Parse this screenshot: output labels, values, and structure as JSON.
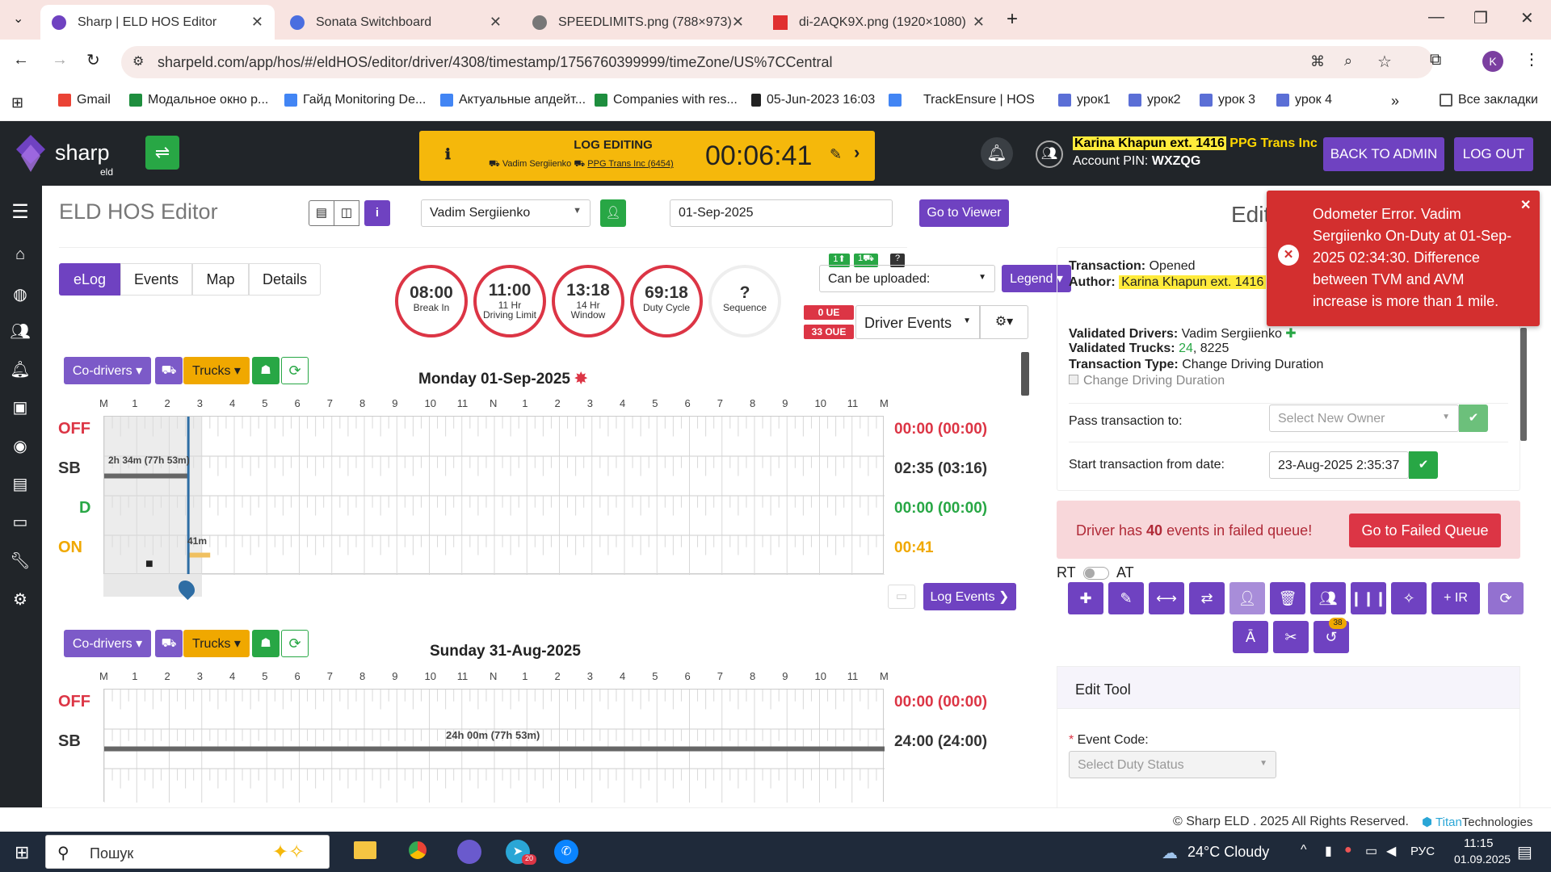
{
  "browser": {
    "tabs": [
      {
        "title": "Sharp | ELD HOS Editor",
        "active": true
      },
      {
        "title": "Sonata Switchboard",
        "active": false
      },
      {
        "title": "SPEEDLIMITS.png (788×973)",
        "active": false
      },
      {
        "title": "di-2AQK9X.png (1920×1080)",
        "active": false
      }
    ],
    "url": "sharpeld.com/app/hos/#/eldHOS/editor/driver/4308/timestamp/1756760399999/timeZone/US%7CCentral",
    "profile_initial": "K",
    "bookmarks": [
      "Gmail",
      "Модальное окно р...",
      "Гайд Monitoring De...",
      "Актуальные апдейт...",
      "Companies with res...",
      "05-Jun-2023 16:03",
      "TrackEnsure | HOS",
      "урок1",
      "урок2",
      "урок 3",
      "урок 4"
    ],
    "all_bookmarks": "Все закладки"
  },
  "header": {
    "logo_text": "sharp",
    "logo_sub": "eld",
    "log_editing_title": "LOG EDITING",
    "log_editing_driver": "Vadim Sergiienko",
    "log_editing_company": "PPG Trans Inc (6454)",
    "timer": "00:06:41",
    "user_name": "Karina Khapun ext. 1416",
    "company": "PPG Trans Inc",
    "pin_label": "Account PIN:",
    "pin_value": "WXZQG",
    "back_to_admin": "BACK TO ADMIN",
    "log_out": "LOG OUT"
  },
  "toolbar": {
    "page_title": "ELD HOS Editor",
    "driver_select": "Vadim Sergiienko",
    "date": "01-Sep-2025",
    "go_viewer": "Go to Viewer",
    "tabs": [
      "eLog",
      "Events",
      "Map",
      "Details"
    ]
  },
  "clocks": [
    {
      "time": "08:00",
      "label": "Break In",
      "sub": ""
    },
    {
      "time": "11:00",
      "label": "Driving Limit",
      "sub": "11 Hr"
    },
    {
      "time": "13:18",
      "label": "Window",
      "sub": "14 Hr"
    },
    {
      "time": "69:18",
      "label": "Duty Cycle",
      "sub": ""
    },
    {
      "time": "?",
      "label": "Sequence",
      "sub": ""
    }
  ],
  "upload": {
    "badge1": "1",
    "badge2": "1",
    "badge3": "?",
    "label": "Can be uploaded:",
    "legend": "Legend",
    "ue": "0 UE",
    "oue": "33 OUE",
    "driver_events": "Driver Events"
  },
  "days": [
    {
      "title": "Monday 01-Sep-2025",
      "totals": [
        "00:00 (00:00)",
        "02:35 (03:16)",
        "00:00 (00:00)",
        "00:41"
      ],
      "sb_label": "2h 34m (77h 53m)",
      "on_label": "41m"
    },
    {
      "title": "Sunday 31-Aug-2025",
      "totals": [
        "00:00 (00:00)",
        "24:00 (24:00)"
      ],
      "sb_label": "24h 00m (77h 53m)"
    }
  ],
  "status_rows": [
    "OFF",
    "SB",
    "D",
    "ON"
  ],
  "hours": [
    "M",
    "1",
    "2",
    "3",
    "4",
    "5",
    "6",
    "7",
    "8",
    "9",
    "10",
    "11",
    "N",
    "1",
    "2",
    "3",
    "4",
    "5",
    "6",
    "7",
    "8",
    "9",
    "10",
    "11",
    "M"
  ],
  "grid_buttons": {
    "codrivers": "Co-drivers",
    "trucks": "Trucks",
    "log_events": "Log Events"
  },
  "right": {
    "edit_title": "Edit",
    "transaction_label": "Transaction:",
    "transaction": "Opened",
    "author_label": "Author:",
    "author": "Karina Khapun ext. 1416",
    "validated_drivers_label": "Validated Drivers:",
    "validated_drivers": "Vadim Sergiienko",
    "validated_trucks_label": "Validated Trucks:",
    "truck1": "24",
    "truck2": ", 8225",
    "type_label": "Transaction Type:",
    "type": "Change Driving Duration",
    "checkbox": "Change Driving Duration",
    "pass_label": "Pass transaction to:",
    "pass_placeholder": "Select New Owner",
    "start_label": "Start transaction from date:",
    "start_value": "23-Aug-2025 2:35:37",
    "failed_pre": "Driver has ",
    "failed_count": "40",
    "failed_post": " events in failed queue!",
    "go_failed": "Go to Failed Queue",
    "rt": "RT",
    "at": "AT",
    "ir": "+ IR",
    "badge": "38",
    "edit_tool": "Edit Tool",
    "event_code_label": "Event Code:",
    "event_code_placeholder": "Select Duty Status"
  },
  "toast": "Odometer Error. Vadim Sergiienko On-Duty at 01-Sep-2025 02:34:30. Difference between TVM and AVM increase is more than 1 mile.",
  "footer": {
    "copyright": "© Sharp ELD . 2025 All Rights Reserved.",
    "brand": "Titan",
    "brand2": "Technologies"
  },
  "taskbar": {
    "search": "Пошук",
    "weather": "24°C Cloudy",
    "lang": "РУС",
    "time": "11:15",
    "date": "01.09.2025",
    "telegram_badge": "20"
  }
}
